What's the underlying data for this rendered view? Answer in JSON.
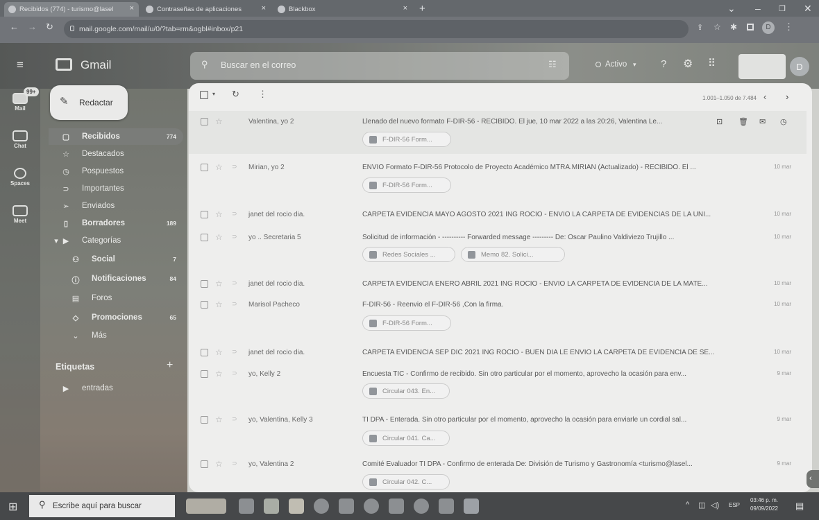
{
  "browser": {
    "tabs": [
      {
        "title": "Recibidos (774) - turismo@lasel"
      },
      {
        "title": "Contraseñas de aplicaciones"
      },
      {
        "title": "Blackbox"
      }
    ],
    "url": "mail.google.com/mail/u/0/?tab=rm&ogbl#inbox/p21"
  },
  "gmail": {
    "logo_text": "Gmail",
    "search_placeholder": "Buscar en el correo",
    "status": "Activo",
    "avatar_letter": "D",
    "compose_label": "Redactar",
    "rail": [
      {
        "label": "Mail",
        "badge": "99+"
      },
      {
        "label": "Chat"
      },
      {
        "label": "Spaces"
      },
      {
        "label": "Meet"
      }
    ],
    "nav": [
      {
        "label": "Recibidos",
        "count": "774"
      },
      {
        "label": "Destacados",
        "count": ""
      },
      {
        "label": "Pospuestos",
        "count": ""
      },
      {
        "label": "Importantes",
        "count": ""
      },
      {
        "label": "Enviados",
        "count": ""
      },
      {
        "label": "Borradores",
        "count": "189"
      },
      {
        "label": "Categorías",
        "count": ""
      },
      {
        "label": "Social",
        "count": "7"
      },
      {
        "label": "Notificaciones",
        "count": "84"
      },
      {
        "label": "Foros",
        "count": ""
      },
      {
        "label": "Promociones",
        "count": "65"
      },
      {
        "label": "Más",
        "count": ""
      }
    ],
    "labels_heading": "Etiquetas",
    "labels": [
      {
        "label": "entradas"
      }
    ],
    "pagination": "1.001–1.050 de 7.484",
    "emails": [
      {
        "sender": "Valentina, yo 2",
        "subject": "Llenado del nuevo formato F-DIR-56 - RECIBIDO. El jue, 10 mar 2022 a las 20:26, Valentina Le...",
        "date": "",
        "attachments": [
          "F-DIR-56 Form..."
        ]
      },
      {
        "sender": "Mirian, yo 2",
        "subject": "ENVIO Formato F-DIR-56 Protocolo de Proyecto Académico MTRA.MIRIAN (Actualizado) - RECIBIDO. El ...",
        "date": "10 mar",
        "attachments": [
          "F-DIR-56 Form..."
        ]
      },
      {
        "sender": "janet del rocio dia.",
        "subject": "CARPETA EVIDENCIA MAYO AGOSTO 2021 ING ROCIO - ENVIO LA CARPETA DE EVIDENCIAS DE LA UNI...",
        "date": "10 mar",
        "attachments": []
      },
      {
        "sender": "yo .. Secretaria 5",
        "subject": "Solicitud de información - ---------- Forwarded message --------- De: Oscar Paulino Valdiviezo Trujillo ...",
        "date": "10 mar",
        "attachments": [
          "Redes Sociales ...",
          "Memo 82. Solici..."
        ]
      },
      {
        "sender": "janet del rocio dia.",
        "subject": "CARPETA EVIDENCIA ENERO ABRIL 2021 ING ROCIO - ENVIO LA CARPETA DE EVIDENCIA DE LA MATE...",
        "date": "10 mar",
        "attachments": []
      },
      {
        "sender": "Marisol Pacheco",
        "subject": "F-DIR-56 - Reenvio el F-DIR-56 ,Con la firma.",
        "date": "10 mar",
        "attachments": [
          "F-DIR-56 Form..."
        ]
      },
      {
        "sender": "janet del rocio dia.",
        "subject": "CARPETA EVIDENCIA SEP DIC 2021 ING ROCIO - BUEN DIA LE ENVIO LA CARPETA DE EVIDENCIA DE SE...",
        "date": "10 mar",
        "attachments": []
      },
      {
        "sender": "yo, Kelly 2",
        "subject": "Encuesta TIC - Confirmo de recibido. Sin otro particular por el momento, aprovecho la ocasión para env...",
        "date": "9 mar",
        "attachments": [
          "Circular 043. En..."
        ]
      },
      {
        "sender": "yo, Valentina, Kelly 3",
        "subject": "TI DPA - Enterada. Sin otro particular por el momento, aprovecho la ocasión para enviarle un cordial sal...",
        "date": "9 mar",
        "attachments": [
          "Circular 041. Ca..."
        ]
      },
      {
        "sender": "yo, Valentina 2",
        "subject": "Comité Evaluador TI DPA - Confirmo de enterada De: División de Turismo y Gastronomía <turismo@lasel...",
        "date": "9 mar",
        "attachments": [
          "Circular 042. C..."
        ]
      }
    ]
  },
  "taskbar": {
    "search_placeholder": "Escribe aquí para buscar",
    "lang": "ESP",
    "time": "03:46 p. m.",
    "date": "09/09/2022"
  },
  "colors": {
    "panel": "#f7f8f6",
    "header": "#6c736c",
    "taskbar": "#3f4447"
  }
}
